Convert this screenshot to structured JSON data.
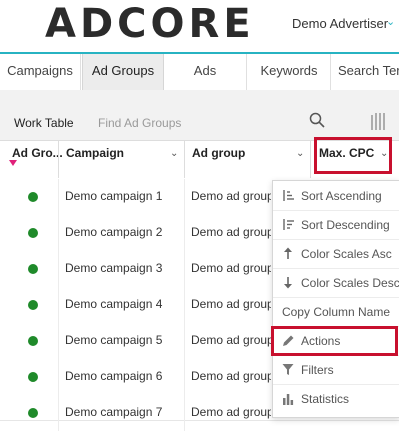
{
  "header": {
    "logo": "ADCORE",
    "advertiser": "Demo Advertiser",
    "advertiser_chevron": "chevron-down-icon"
  },
  "tabs": [
    {
      "label": "Campaigns",
      "active": false
    },
    {
      "label": "Ad Groups",
      "active": true
    },
    {
      "label": "Ads",
      "active": false
    },
    {
      "label": "Keywords",
      "active": false
    },
    {
      "label": "Search Term",
      "active": false
    }
  ],
  "toolbar": {
    "work_table": "Work Table",
    "find_placeholder": "Find Ad Groups",
    "search_icon": "search-icon",
    "columns_icon": "columns-icon"
  },
  "table": {
    "columns": [
      "Ad Gro...",
      "Campaign",
      "Ad group",
      "Max. CPC"
    ],
    "rows": [
      {
        "campaign": "Demo campaign 1",
        "ad_group": "Demo ad group"
      },
      {
        "campaign": "Demo campaign 2",
        "ad_group": "Demo ad group"
      },
      {
        "campaign": "Demo campaign 3",
        "ad_group": "Demo ad group"
      },
      {
        "campaign": "Demo campaign 4",
        "ad_group": "Demo ad group"
      },
      {
        "campaign": "Demo campaign 5",
        "ad_group": "Demo ad group"
      },
      {
        "campaign": "Demo campaign 6",
        "ad_group": "Demo ad group"
      },
      {
        "campaign": "Demo campaign 7",
        "ad_group": "Demo ad group"
      }
    ],
    "status_color": "#1f8a2a"
  },
  "context_menu": {
    "items": [
      {
        "label": "Sort Ascending",
        "icon": "sort-ascending-icon"
      },
      {
        "label": "Sort Descending",
        "icon": "sort-descending-icon"
      },
      {
        "label": "Color Scales Asc",
        "icon": "arrow-up-icon"
      },
      {
        "label": "Color Scales Desc",
        "icon": "arrow-down-icon"
      },
      {
        "label": "Copy Column Name",
        "icon": ""
      },
      {
        "label": "Actions",
        "icon": "pencil-icon"
      },
      {
        "label": "Filters",
        "icon": "filter-icon"
      },
      {
        "label": "Statistics",
        "icon": "bar-chart-icon"
      }
    ]
  },
  "colors": {
    "accent": "#27b3c2",
    "highlight": "#c8102e",
    "filter_marker": "#e0207a"
  }
}
